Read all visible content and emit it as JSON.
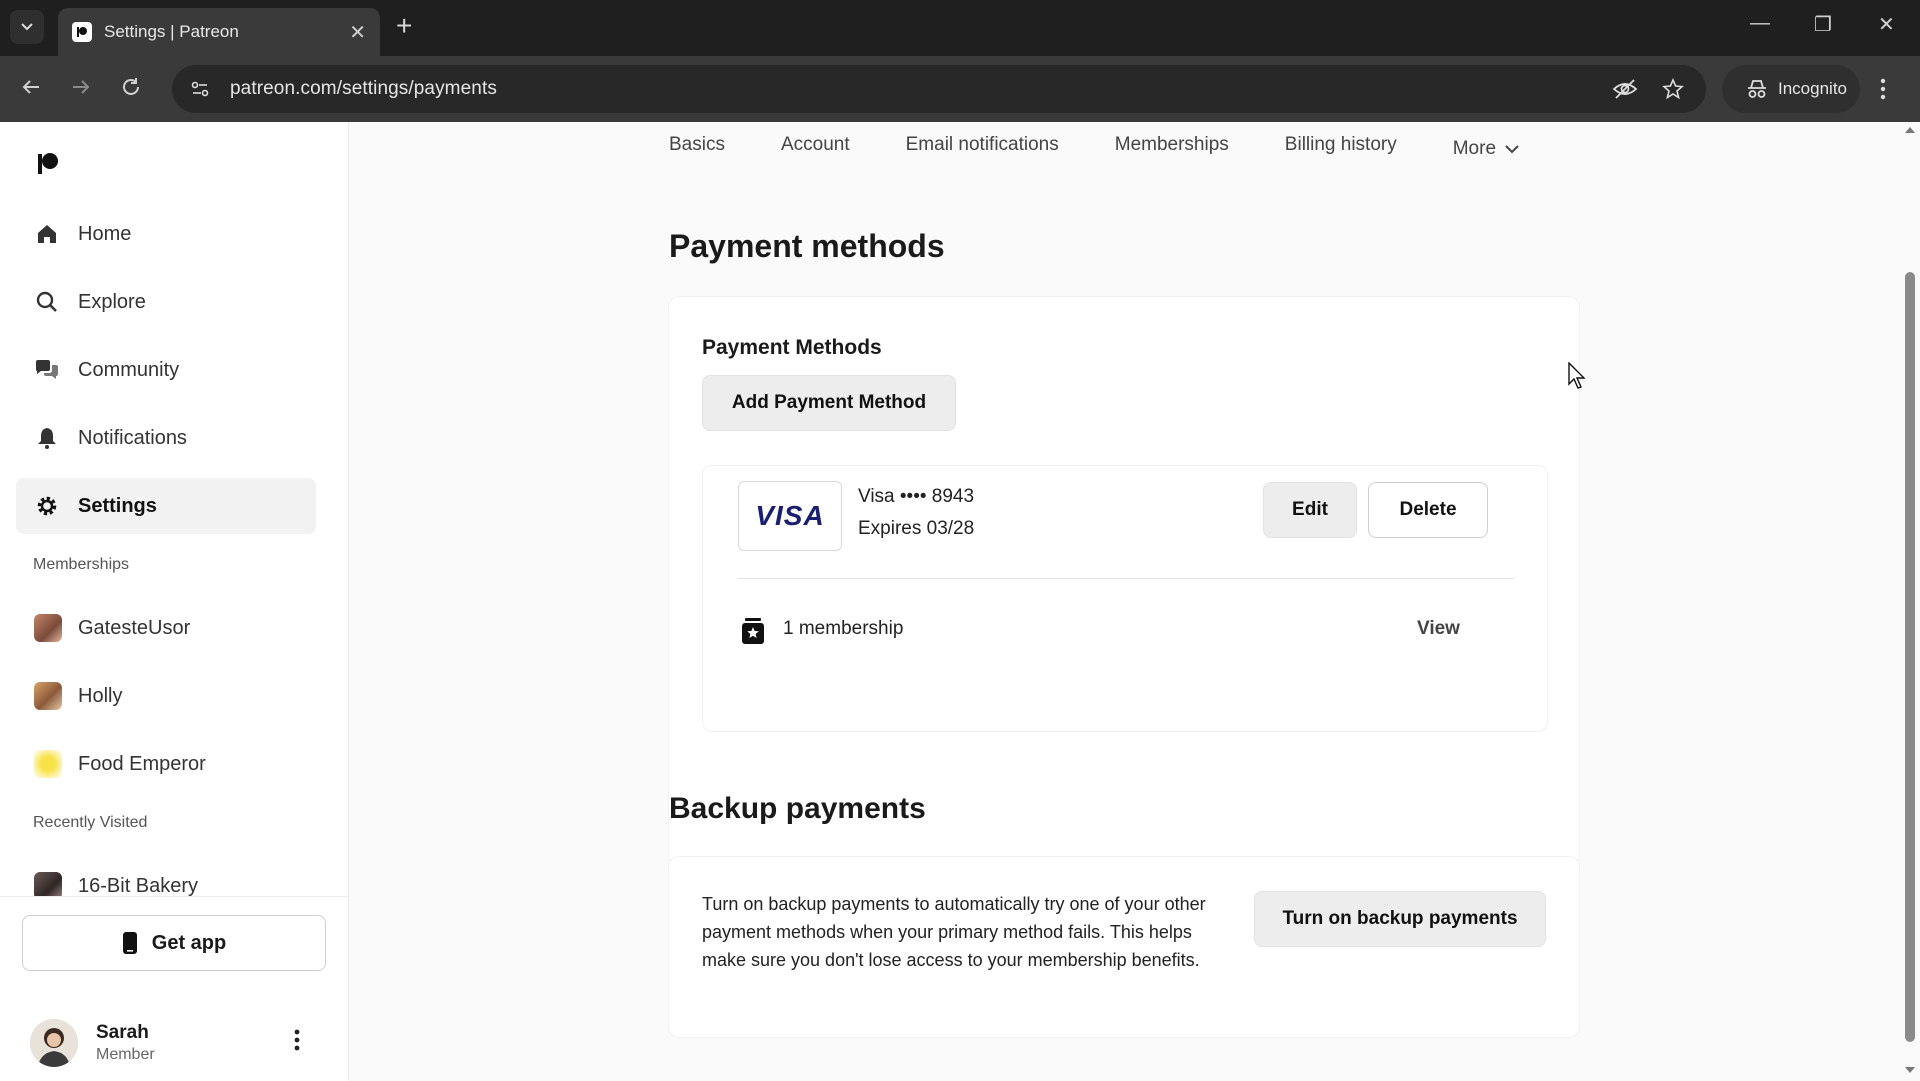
{
  "browser": {
    "tab_title": "Settings | Patreon",
    "url": "patreon.com/settings/payments",
    "incognito_label": "Incognito"
  },
  "sidebar": {
    "nav": [
      {
        "label": "Home",
        "icon": "home-icon"
      },
      {
        "label": "Explore",
        "icon": "search-icon"
      },
      {
        "label": "Community",
        "icon": "chat-icon"
      },
      {
        "label": "Notifications",
        "icon": "bell-icon"
      },
      {
        "label": "Settings",
        "icon": "gear-icon"
      }
    ],
    "memberships_label": "Memberships",
    "memberships": [
      {
        "name": "GatesteUsor"
      },
      {
        "name": "Holly"
      },
      {
        "name": "Food Emperor"
      }
    ],
    "recently_visited_label": "Recently Visited",
    "recently_visited": [
      {
        "name": "16-Bit Bakery"
      }
    ],
    "get_app_label": "Get app",
    "user": {
      "name": "Sarah",
      "role": "Member"
    }
  },
  "main": {
    "tabs": [
      "Basics",
      "Account",
      "Email notifications",
      "Memberships",
      "Billing history",
      "More"
    ],
    "page_title": "Payment methods",
    "payment_card": {
      "title": "Payment Methods",
      "add_button": "Add Payment Method",
      "card_brand": "VISA",
      "card_number": "Visa •••• 8943",
      "card_expiry": "Expires 03/28",
      "edit_button": "Edit",
      "delete_button": "Delete",
      "membership_count": "1 membership",
      "view_link": "View"
    },
    "backup": {
      "title": "Backup payments",
      "description": "Turn on backup payments to automatically try one of your other payment methods when your primary method fails. This helps make sure you don't lose access to your membership benefits.",
      "button": "Turn on backup payments"
    }
  },
  "colors": {
    "chrome_dark": "#1f1f1f",
    "chrome_toolbar": "#3a3a3a",
    "visa_blue": "#1a1f71",
    "active_nav_bg": "#f2f2f2"
  }
}
